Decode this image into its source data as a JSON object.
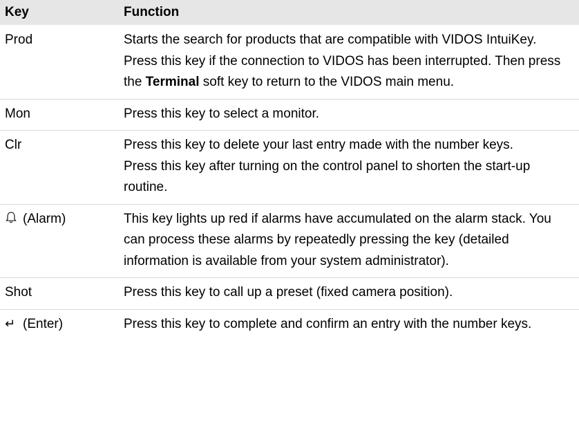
{
  "header": {
    "key": "Key",
    "function": "Function"
  },
  "rows": [
    {
      "key": "Prod",
      "paragraphs": [
        "Starts the search for products that are compatible with VIDOS IntuiKey.",
        {
          "before": "Press this key if the connection to VIDOS has been interrupted. Then press the ",
          "bold": "Terminal",
          "after": " soft key to return to the VIDOS main menu."
        }
      ]
    },
    {
      "key": "Mon",
      "paragraphs": [
        "Press this key to select a monitor."
      ]
    },
    {
      "key": "Clr",
      "paragraphs": [
        "Press this key to delete your last entry made with the number keys.",
        "Press this key after turning on the control panel to shorten the start-up routine."
      ]
    },
    {
      "key": "(Alarm)",
      "icon": "bell-icon",
      "icon_glyph": "🔔",
      "paragraphs": [
        "This key lights up red if alarms have accumulated on the alarm stack. You can process these alarms by repeatedly pressing the key (detailed information is available from your system administrator)."
      ]
    },
    {
      "key": "Shot",
      "paragraphs": [
        "Press this key to call up a preset (fixed camera position)."
      ]
    },
    {
      "key": "(Enter)",
      "icon": "enter-icon",
      "icon_glyph": "↵",
      "paragraphs": [
        "Press this key to complete and confirm an entry with the number keys."
      ]
    }
  ]
}
